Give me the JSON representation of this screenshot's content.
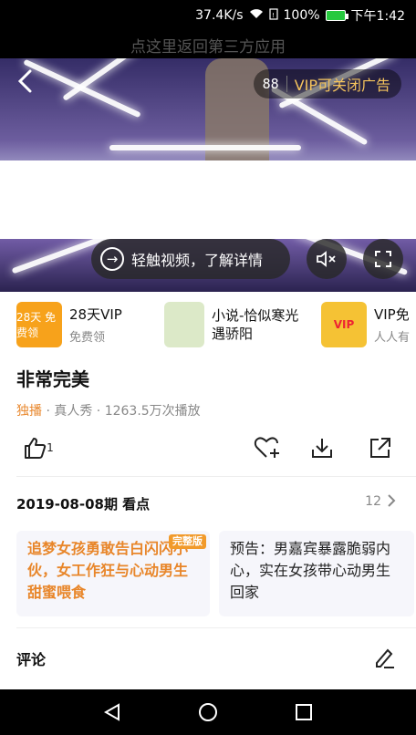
{
  "status": {
    "speed": "37.4K/s",
    "battery": "100%",
    "time": "下午1:42"
  },
  "return_bar": {
    "label": "点这里返回第三方应用"
  },
  "video": {
    "vip_ad_counter": "88",
    "vip_ad_label": "VIP可关闭广告",
    "touch_label": "轻触视频，了解详情"
  },
  "ads": [
    {
      "title": "28天VIP",
      "sub": "免费领",
      "thumb_text": "28天 免费领",
      "color": "#f7a21b"
    },
    {
      "title": "小说-恰似寒光遇骄阳",
      "sub": "",
      "thumb_text": "",
      "color": "#dce9c8"
    },
    {
      "title": "VIP免",
      "sub": "人人有",
      "thumb_text": "VIP",
      "color": "#f5c234"
    }
  ],
  "show": {
    "title": "非常完美",
    "tag_exclusive": "独播",
    "meta_rest": " · 真人秀 · 1263.5万次播放",
    "like_count": "1"
  },
  "episode": {
    "heading": "2019-08-08期 看点",
    "count": "12"
  },
  "cards": [
    {
      "text": "追梦女孩勇敢告白闪闪小伙，女工作狂与心动男生甜蜜喂食",
      "badge": "完整版"
    },
    {
      "text": "预告：男嘉宾暴露脆弱内心，实在女孩带心动男生回家"
    }
  ],
  "comments": {
    "title": "评论"
  }
}
